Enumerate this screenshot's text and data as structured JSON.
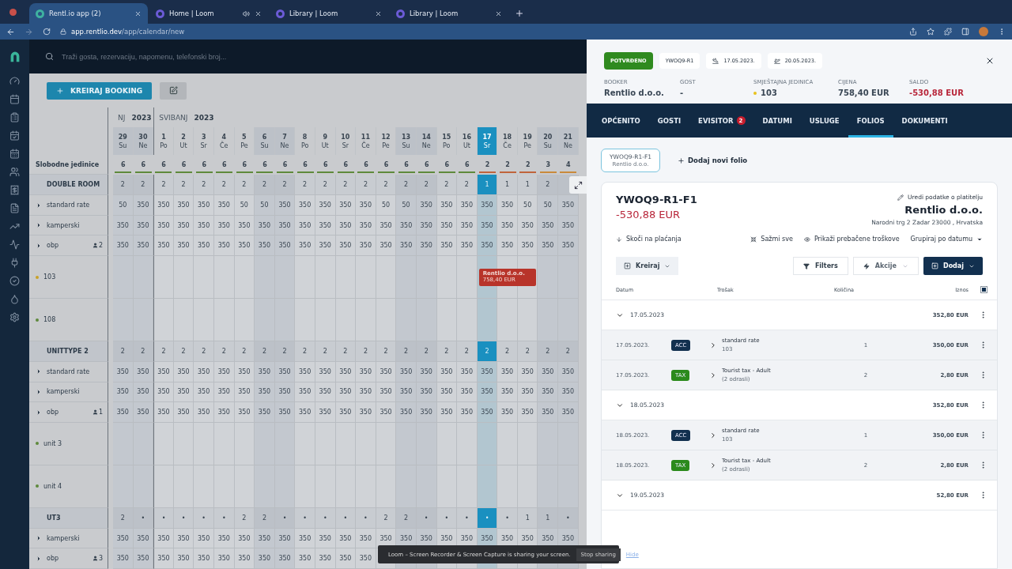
{
  "browser": {
    "tabs": [
      {
        "title": "Rentl.io app (2)",
        "selected": true,
        "muted": false
      },
      {
        "title": "Home | Loom",
        "selected": false,
        "muted": true
      },
      {
        "title": "Library | Loom",
        "selected": false,
        "muted": false
      },
      {
        "title": "Library | Loom",
        "selected": false,
        "muted": false
      }
    ],
    "url_host": "app.rentlio.dev",
    "url_path": "/app/calendar/new"
  },
  "search": {
    "placeholder": "Traži gosta, rezervaciju, napomenu, telefonski broj..."
  },
  "toolbar": {
    "create_button": "KREIRAJ BOOKING"
  },
  "calendar": {
    "free_units_label": "Slobodne jedinice",
    "months": [
      {
        "name": "NJ",
        "year": "2023"
      },
      {
        "name": "SVIBANJ",
        "year": "2023"
      }
    ],
    "days": [
      {
        "num": "29",
        "dow": "Su",
        "weekend": true,
        "selected": false,
        "month_start": false
      },
      {
        "num": "30",
        "dow": "Ne",
        "weekend": true,
        "selected": false,
        "month_start": false
      },
      {
        "num": "1",
        "dow": "Po",
        "weekend": false,
        "selected": false,
        "month_start": true
      },
      {
        "num": "2",
        "dow": "Ut",
        "weekend": false,
        "selected": false,
        "month_start": false
      },
      {
        "num": "3",
        "dow": "Sr",
        "weekend": false,
        "selected": false,
        "month_start": false
      },
      {
        "num": "4",
        "dow": "Če",
        "weekend": false,
        "selected": false,
        "month_start": false
      },
      {
        "num": "5",
        "dow": "Pe",
        "weekend": false,
        "selected": false,
        "month_start": false
      },
      {
        "num": "6",
        "dow": "Su",
        "weekend": true,
        "selected": false,
        "month_start": false
      },
      {
        "num": "7",
        "dow": "Ne",
        "weekend": true,
        "selected": false,
        "month_start": false
      },
      {
        "num": "8",
        "dow": "Po",
        "weekend": false,
        "selected": false,
        "month_start": false
      },
      {
        "num": "9",
        "dow": "Ut",
        "weekend": false,
        "selected": false,
        "month_start": false
      },
      {
        "num": "10",
        "dow": "Sr",
        "weekend": false,
        "selected": false,
        "month_start": false
      },
      {
        "num": "11",
        "dow": "Če",
        "weekend": false,
        "selected": false,
        "month_start": false
      },
      {
        "num": "12",
        "dow": "Pe",
        "weekend": false,
        "selected": false,
        "month_start": false
      },
      {
        "num": "13",
        "dow": "Su",
        "weekend": true,
        "selected": false,
        "month_start": false
      },
      {
        "num": "14",
        "dow": "Ne",
        "weekend": true,
        "selected": false,
        "month_start": false
      },
      {
        "num": "15",
        "dow": "Po",
        "weekend": false,
        "selected": false,
        "month_start": false
      },
      {
        "num": "16",
        "dow": "Ut",
        "weekend": false,
        "selected": false,
        "month_start": false
      },
      {
        "num": "17",
        "dow": "Sr",
        "weekend": false,
        "selected": true,
        "month_start": false
      },
      {
        "num": "18",
        "dow": "Če",
        "weekend": false,
        "selected": false,
        "month_start": false
      },
      {
        "num": "19",
        "dow": "Pe",
        "weekend": false,
        "selected": false,
        "month_start": false
      },
      {
        "num": "20",
        "dow": "Su",
        "weekend": true,
        "selected": false,
        "month_start": false
      },
      {
        "num": "21",
        "dow": "Ne",
        "weekend": true,
        "selected": false,
        "month_start": false
      }
    ],
    "free_units": [
      {
        "value": "6",
        "color": "#5e8a3c"
      },
      {
        "value": "6",
        "color": "#5e8a3c"
      },
      {
        "value": "6",
        "color": "#5e8a3c"
      },
      {
        "value": "6",
        "color": "#5e8a3c"
      },
      {
        "value": "6",
        "color": "#5e8a3c"
      },
      {
        "value": "6",
        "color": "#5e8a3c"
      },
      {
        "value": "6",
        "color": "#5e8a3c"
      },
      {
        "value": "6",
        "color": "#5e8a3c"
      },
      {
        "value": "6",
        "color": "#5e8a3c"
      },
      {
        "value": "6",
        "color": "#5e8a3c"
      },
      {
        "value": "6",
        "color": "#5e8a3c"
      },
      {
        "value": "6",
        "color": "#5e8a3c"
      },
      {
        "value": "6",
        "color": "#5e8a3c"
      },
      {
        "value": "6",
        "color": "#5e8a3c"
      },
      {
        "value": "6",
        "color": "#5e8a3c"
      },
      {
        "value": "6",
        "color": "#5e8a3c"
      },
      {
        "value": "6",
        "color": "#5e8a3c"
      },
      {
        "value": "6",
        "color": "#5e8a3c"
      },
      {
        "value": "2",
        "color": "#c0643c"
      },
      {
        "value": "2",
        "color": "#c0643c"
      },
      {
        "value": "2",
        "color": "#c0643c"
      },
      {
        "value": "3",
        "color": "#c98a3c"
      },
      {
        "value": "4",
        "color": "#c98a3c"
      }
    ],
    "groups": [
      {
        "name": "DOUBLE ROOM",
        "counts": [
          "2",
          "2",
          "2",
          "2",
          "2",
          "2",
          "2",
          "2",
          "2",
          "2",
          "2",
          "2",
          "2",
          "2",
          "2",
          "2",
          "2",
          "2",
          "1",
          "1",
          "1",
          "2"
        ],
        "rates": [
          {
            "name": "standard rate",
            "values": [
              "50",
              "350",
              "350",
              "350",
              "350",
              "350",
              "50",
              "50",
              "350",
              "350",
              "350",
              "350",
              "350",
              "50",
              "50",
              "350",
              "350",
              "350",
              "350",
              "350",
              "50",
              "50",
              "350"
            ]
          },
          {
            "name": "kamperski",
            "values": [
              "350",
              "350",
              "350",
              "350",
              "350",
              "350",
              "350",
              "350",
              "350",
              "350",
              "350",
              "350",
              "350",
              "350",
              "350",
              "350",
              "350",
              "350",
              "350",
              "350",
              "350",
              "350",
              "350"
            ]
          },
          {
            "name": "obp",
            "guests": "2",
            "values": [
              "350",
              "350",
              "350",
              "350",
              "350",
              "350",
              "350",
              "350",
              "350",
              "350",
              "350",
              "350",
              "350",
              "350",
              "350",
              "350",
              "350",
              "350",
              "350",
              "350",
              "350",
              "350",
              "350"
            ]
          }
        ],
        "units": [
          {
            "name": "103",
            "color": "#c9a227",
            "booking": {
              "guest": "Rentlio d.o.o.",
              "price": "758,40 EUR"
            }
          },
          {
            "name": "108",
            "color": "#5e8a3c"
          }
        ]
      },
      {
        "name": "UNITTYPE 2",
        "counts": [
          "2",
          "2",
          "2",
          "2",
          "2",
          "2",
          "2",
          "2",
          "2",
          "2",
          "2",
          "2",
          "2",
          "2",
          "2",
          "2",
          "2",
          "2",
          "2",
          "2",
          "2",
          "2",
          "2"
        ],
        "rates": [
          {
            "name": "standard rate",
            "values": [
              "350",
              "350",
              "350",
              "350",
              "350",
              "350",
              "350",
              "350",
              "350",
              "350",
              "350",
              "350",
              "350",
              "350",
              "350",
              "350",
              "350",
              "350",
              "350",
              "350",
              "350",
              "350",
              "350"
            ]
          },
          {
            "name": "kamperski",
            "values": [
              "350",
              "350",
              "350",
              "350",
              "350",
              "350",
              "350",
              "350",
              "350",
              "350",
              "350",
              "350",
              "350",
              "350",
              "350",
              "350",
              "350",
              "350",
              "350",
              "350",
              "350",
              "350",
              "350"
            ]
          },
          {
            "name": "obp",
            "guests": "1",
            "values": [
              "350",
              "350",
              "350",
              "350",
              "350",
              "350",
              "350",
              "350",
              "350",
              "350",
              "350",
              "350",
              "350",
              "350",
              "350",
              "350",
              "350",
              "350",
              "350",
              "350",
              "350",
              "350",
              "350"
            ]
          }
        ],
        "units": [
          {
            "name": "unit 3",
            "color": "#5e8a3c"
          },
          {
            "name": "unit 4",
            "color": "#5e8a3c"
          }
        ]
      },
      {
        "name": "UT3",
        "counts": [
          "2",
          "•",
          "•",
          "•",
          "•",
          "•",
          "2",
          "2",
          "•",
          "•",
          "•",
          "•",
          "•",
          "2",
          "2",
          "•",
          "•",
          "•",
          "•",
          "•",
          "1",
          "1",
          "•"
        ],
        "rates": [
          {
            "name": "kamperski",
            "values": [
              "350",
              "350",
              "350",
              "350",
              "350",
              "350",
              "350",
              "350",
              "350",
              "350",
              "350",
              "350",
              "350",
              "350",
              "350",
              "350",
              "350",
              "350",
              "350",
              "350",
              "350",
              "350",
              "350"
            ]
          },
          {
            "name": "obp",
            "guests": "3",
            "values": [
              "350",
              "350",
              "350",
              "350",
              "350",
              "350",
              "350",
              "350",
              "350",
              "350",
              "350",
              "350",
              "350"
            ]
          }
        ]
      }
    ]
  },
  "panel": {
    "status": "POTVRĐENO",
    "code": "YWOQ9-R1",
    "arrival": "17.05.2023.",
    "departure": "20.05.2023.",
    "info": [
      {
        "label": "BOOKER",
        "value": "Rentlio d.o.o.",
        "negative": false
      },
      {
        "label": "GOST",
        "value": "-",
        "negative": false
      },
      {
        "label": "SMJEŠTAJNA JEDINICA",
        "value": "103",
        "negative": false,
        "color": "#e8c21e"
      },
      {
        "label": "CIJENA",
        "value": "758,40 EUR",
        "negative": false
      },
      {
        "label": "SALDO",
        "value": "-530,88 EUR",
        "negative": true
      }
    ],
    "tabs": [
      {
        "label": "OPĆENITO",
        "selected": false
      },
      {
        "label": "GOSTI",
        "selected": false
      },
      {
        "label": "EVISITOR",
        "selected": false,
        "badge": "2"
      },
      {
        "label": "DATUMI",
        "selected": false
      },
      {
        "label": "USLUGE",
        "selected": false
      },
      {
        "label": "FOLIOS",
        "selected": true
      },
      {
        "label": "DOKUMENTI",
        "selected": false
      }
    ],
    "folios": [
      {
        "code": "YWOQ9-R1-F1",
        "payer": "Rentlio d.o.o.",
        "selected": true
      }
    ],
    "add_folio": "Dodaj novi folio",
    "card": {
      "title": "YWOQ9-R1-F1",
      "balance": "-530,88 EUR",
      "edit_link": "Uredi podatke o platitelju",
      "payer": "Rentlio d.o.o.",
      "address": "Narodni trg 2 Zadar 23000 , Hrvatska",
      "jump": "Skoči na plaćanja",
      "collapse": "Sažmi sve",
      "show_transferred": "Prikaži prebačene troškove",
      "group_by": "Grupiraj po datumu",
      "create": "Kreiraj",
      "filters": "Filters",
      "actions": "Akcije",
      "add": "Dodaj",
      "columns": [
        "Datum",
        "Trošak",
        "Količina",
        "Iznos"
      ],
      "select_all_checked": true,
      "groups": [
        {
          "date": "17.05.2023",
          "total": "352,80 EUR",
          "expanded": true,
          "items": [
            {
              "date": "17.05.2023.",
              "kind": "acc",
              "badge": "ACC",
              "name": "standard rate",
              "detail": "103",
              "qty": "1",
              "amount": "350,00 EUR"
            },
            {
              "date": "17.05.2023.",
              "kind": "tax",
              "badge": "TAX",
              "name": "Tourist tax - Adult",
              "detail": "(2 odrasli)",
              "qty": "2",
              "amount": "2,80 EUR"
            }
          ]
        },
        {
          "date": "18.05.2023",
          "total": "352,80 EUR",
          "expanded": true,
          "items": [
            {
              "date": "18.05.2023.",
              "kind": "acc",
              "badge": "ACC",
              "name": "standard rate",
              "detail": "103",
              "qty": "1",
              "amount": "350,00 EUR"
            },
            {
              "date": "18.05.2023.",
              "kind": "tax",
              "badge": "TAX",
              "name": "Tourist tax - Adult",
              "detail": "(2 odrasli)",
              "qty": "2",
              "amount": "2,80 EUR"
            }
          ]
        },
        {
          "date": "19.05.2023",
          "total": "52,80 EUR",
          "expanded": true
        }
      ]
    }
  },
  "loom": {
    "message": "Loom – Screen Recorder & Screen Capture is sharing your screen.",
    "stop": "Stop sharing",
    "hide": "Hide"
  }
}
